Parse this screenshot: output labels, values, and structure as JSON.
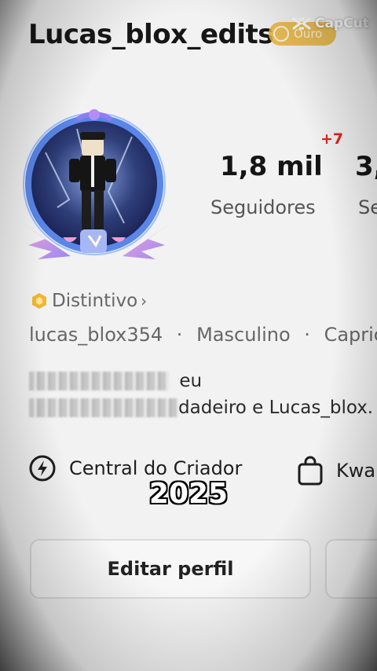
{
  "profile": {
    "username": "Lucas_blox_edits",
    "badge_label": "Ouro",
    "badge_link": "Distintivo",
    "handle": "lucas_blox354",
    "gender": "Masculino",
    "sign_partial": "Capric",
    "separator": "·"
  },
  "watermark": {
    "label": "CapCut"
  },
  "stats": [
    {
      "value": "1,8 mil",
      "label": "Seguidores",
      "delta": "+7"
    },
    {
      "value": "3,",
      "label": "Se"
    }
  ],
  "bio": {
    "line1_visible": "eu",
    "line2_visible": "dadeiro e Lucas_blox."
  },
  "links": {
    "creator_center": "Central do Criador",
    "shop_partial": "Kwa"
  },
  "overlay": {
    "year": "2025"
  },
  "actions": {
    "edit_profile": "Editar perfil"
  },
  "colors": {
    "gold": "#e9b43b",
    "delta_red": "#e0241b",
    "frame_blue": "#5a86e8"
  }
}
